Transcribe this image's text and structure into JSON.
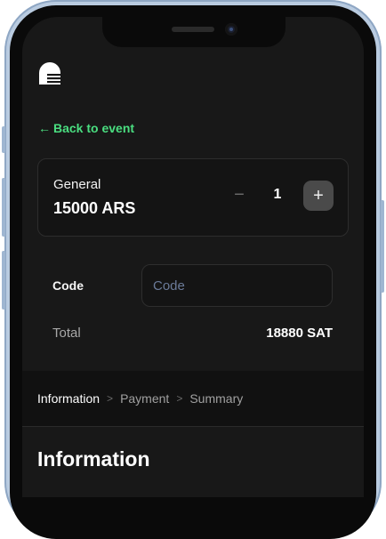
{
  "header": {
    "logo_icon": "app-logo-icon"
  },
  "nav": {
    "back_label": "Back to event",
    "back_icon": "arrow-left-icon",
    "accent_color": "#4ade80"
  },
  "ticket": {
    "name": "General",
    "price": "15000 ARS",
    "quantity": "1",
    "minus_icon": "minus-icon",
    "plus_icon": "plus-icon"
  },
  "discount": {
    "label": "Code",
    "placeholder": "Code",
    "value": ""
  },
  "summary": {
    "total_label": "Total",
    "total_value": "18880 SAT"
  },
  "steps": [
    {
      "label": "Information",
      "active": true
    },
    {
      "label": "Payment",
      "active": false
    },
    {
      "label": "Summary",
      "active": false
    }
  ],
  "section": {
    "title": "Information"
  }
}
